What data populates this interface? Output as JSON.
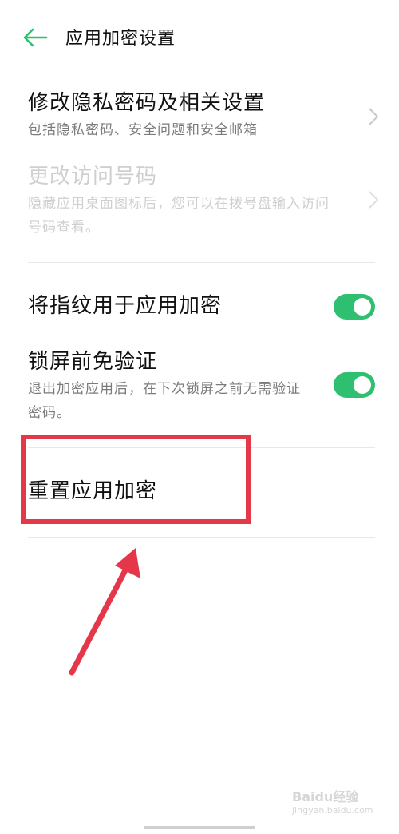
{
  "header": {
    "title": "应用加密设置",
    "back_icon": "arrow-left-icon"
  },
  "items": [
    {
      "title": "修改隐私密码及相关设置",
      "desc": "包括隐私密码、安全问题和安全邮箱",
      "enabled": true
    },
    {
      "title": "更改访问号码",
      "desc_line1": "隐藏应用桌面图标后，您可以在拨号盘输入访问",
      "desc_line2": "号码查看。",
      "enabled": false
    }
  ],
  "toggles": [
    {
      "title": "将指纹用于应用加密",
      "on": true
    },
    {
      "title": "锁屏前免验证",
      "desc_line1": "退出加密应用后，在下次锁屏之前无需验证",
      "desc_line2": "密码。",
      "on": true
    }
  ],
  "reset": {
    "title": "重置应用加密"
  },
  "watermark": {
    "text": "Baidu经验",
    "sub": "jingyan.baidu.com"
  },
  "colors": {
    "accent": "#2fbf71",
    "annotation": "#e5374a",
    "disabled": "#cfcfcf"
  }
}
